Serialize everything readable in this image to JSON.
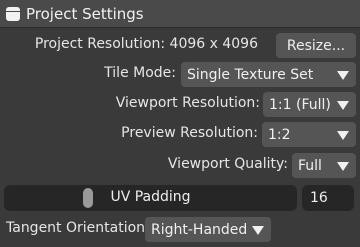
{
  "title": "Project Settings",
  "project_resolution": {
    "label": "Project Resolution: 4096 x 4096",
    "button": "Resize..."
  },
  "tile_mode": {
    "label": "Tile Mode:",
    "value": "Single Texture Set"
  },
  "viewport_resolution": {
    "label": "Viewport Resolution:",
    "value": "1:1 (Full)"
  },
  "preview_resolution": {
    "label": "Preview Resolution:",
    "value": "1:2"
  },
  "viewport_quality": {
    "label": "Viewport Quality:",
    "value": "Full"
  },
  "uv_padding": {
    "label": "UV Padding",
    "value": "16",
    "fraction": 0.28
  },
  "tangent_orientation": {
    "label": "Tangent Orientation",
    "value": "Right-Handed"
  },
  "icons": {
    "title": "folder-icon",
    "caret": "chevron-down-icon"
  }
}
